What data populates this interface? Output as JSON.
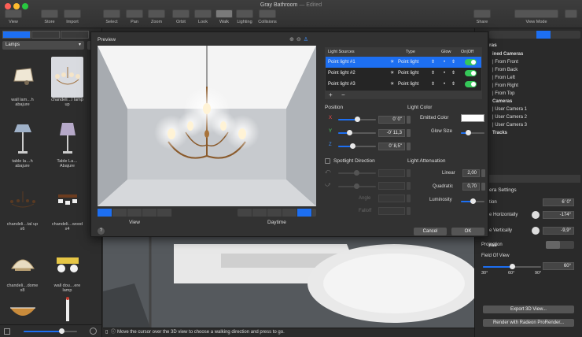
{
  "window": {
    "title": "Gray Bathroom",
    "edited": "— Edited"
  },
  "toolbar": {
    "view": "View",
    "store": "Store",
    "import": "Import",
    "select": "Select",
    "pan": "Pan",
    "zoom": "Zoom",
    "orbit": "Orbit",
    "look": "Look",
    "walk": "Walk",
    "lighting": "Lighting",
    "collisions": "Collisions",
    "share": "Share",
    "view_mode": "View Mode"
  },
  "sidebar": {
    "category": "Lamps",
    "items": [
      {
        "label": "wall lam…h abajure"
      },
      {
        "label": "chandeli…l lamp up"
      },
      {
        "label": "table la…h abajure"
      },
      {
        "label": "Table La…Abajure"
      },
      {
        "label": "chandeli…tal up x6"
      },
      {
        "label": "chandeli…wood x4"
      },
      {
        "label": "chandeli…dome x8"
      },
      {
        "label": "wall dou…ere lamp"
      },
      {
        "label": ""
      },
      {
        "label": ""
      }
    ]
  },
  "dialog": {
    "preview_label": "Preview",
    "view_label": "View",
    "daytime_label": "Daytime",
    "help": "?",
    "cancel": "Cancel",
    "ok": "OK",
    "table_headers": {
      "source": "Light Sources",
      "type": "Type",
      "glow": "Glow",
      "onoff": "On|Off"
    },
    "lights": [
      {
        "name": "Point light #1",
        "type": "Point light",
        "on": true
      },
      {
        "name": "Point light #2",
        "type": "Point light",
        "on": true
      },
      {
        "name": "Point light #3",
        "type": "Point light",
        "on": true
      }
    ],
    "position": {
      "title": "Position",
      "x_label": "X",
      "y_label": "Y",
      "z_label": "Z",
      "x_value": "0' 0\"",
      "y_value": "-0' 11,3",
      "z_value": "0' 8,5\""
    },
    "spot": {
      "title": "Spotlight Direction",
      "angle_label": "Angle",
      "falloff_label": "Falloff"
    },
    "light_color": {
      "title": "Light Color",
      "emitted_label": "Emitted Color",
      "emitted_color": "#ffffff",
      "glow_size_label": "Glow Size"
    },
    "attenuation": {
      "title": "Light Attenuation",
      "linear_label": "Linear",
      "linear_value": "2,00",
      "quadratic_label": "Quadratic",
      "quadratic_value": "0,70",
      "luminosity_label": "Luminosity"
    }
  },
  "right": {
    "section1": "ras",
    "cameras": [
      "ined Cameras",
      "| From Front",
      "| From Back",
      "| From Left",
      "| From Right",
      "| From Top",
      "Cameras",
      "| User Camera 1",
      "| User Camera 2",
      "| User Camera 3",
      "Tracks"
    ],
    "settings_title": "era Settings",
    "position_label": "tion",
    "position_value": "6' 0\"",
    "horiz_label": "e Horizontally",
    "horiz_value": "-174°",
    "vert_label": "e Vertically",
    "vert_value": "-9,9°",
    "extra_label": "ras",
    "projection_label": "Projection",
    "fov_label": "Field Of View",
    "fov_value": "60°",
    "fov_ticks": [
      "30°",
      "60°",
      "90°"
    ],
    "export_button": "Export 3D View...",
    "render_button": "Render with Radeon ProRender..."
  },
  "status": {
    "message": "Move the cursor over the 3D view to choose a walking direction and press to go."
  },
  "colors": {
    "accent": "#1d6ff2",
    "toggle_on": "#35c759"
  }
}
